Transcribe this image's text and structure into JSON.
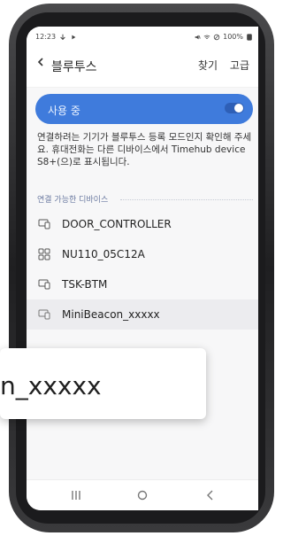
{
  "status": {
    "time": "12:23",
    "battery": "100%"
  },
  "header": {
    "title": "블루투스",
    "find": "찾기",
    "advanced": "고급"
  },
  "toggle": {
    "label": "사용 중",
    "state": "on"
  },
  "info": {
    "text": "연결하려는 기기가 블루투스 등록 모드인지 확인해 주세요. 휴대전화는 다른 디바이스에서 Timehub device S8+(으)로 표시됩니다."
  },
  "section": {
    "available_devices": "연결 가능한 디바이스"
  },
  "devices": [
    {
      "name": "DOOR_CONTROLLER",
      "icon": "device-icon"
    },
    {
      "name": "NU110_05C12A",
      "icon": "grid-icon"
    },
    {
      "name": "TSK-BTM",
      "icon": "device-icon"
    },
    {
      "name": "MiniBeacon_xxxxx",
      "icon": "device-icon"
    }
  ],
  "callout": {
    "text": "n_xxxxx"
  },
  "colors": {
    "accent": "#3f7bdc",
    "frame": "#2a2a2c",
    "screen_bg": "#f7f7f8"
  }
}
